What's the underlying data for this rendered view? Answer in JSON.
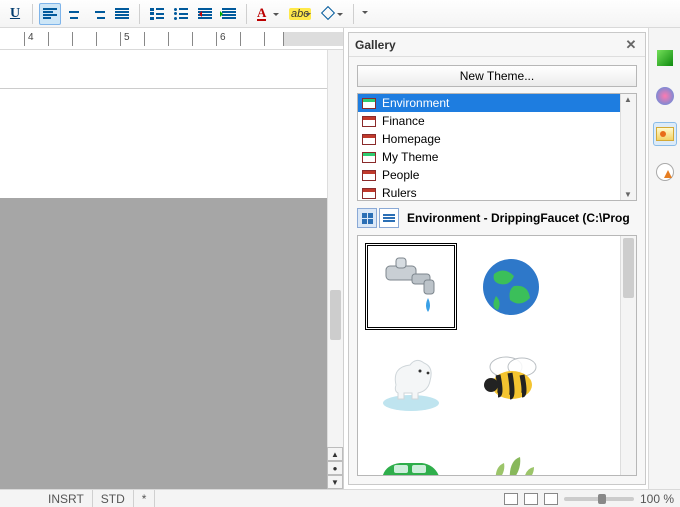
{
  "toolbar": {
    "underline_glyph": "U",
    "fontcolor_glyph": "A",
    "highlight_glyph": "abc"
  },
  "ruler": {
    "marks": [
      "4",
      "5",
      "6"
    ]
  },
  "statusbar": {
    "insrt": "INSRT",
    "std": "STD",
    "star": "*",
    "zoom_label": "100 %"
  },
  "gallery": {
    "title": "Gallery",
    "new_theme_label": "New Theme...",
    "themes": [
      {
        "label": "Environment",
        "selected": true,
        "green": true
      },
      {
        "label": "Finance"
      },
      {
        "label": "Homepage"
      },
      {
        "label": "My Theme",
        "green": true
      },
      {
        "label": "People"
      },
      {
        "label": "Rulers"
      }
    ],
    "path_label": "Environment - DrippingFaucet (C:\\Prog",
    "thumbs": [
      {
        "name": "dripping-faucet",
        "selected": true
      },
      {
        "name": "earth-globe"
      },
      {
        "name": "polar-bear"
      },
      {
        "name": "bee"
      },
      {
        "name": "green-car"
      },
      {
        "name": "plant-sprout"
      }
    ]
  }
}
